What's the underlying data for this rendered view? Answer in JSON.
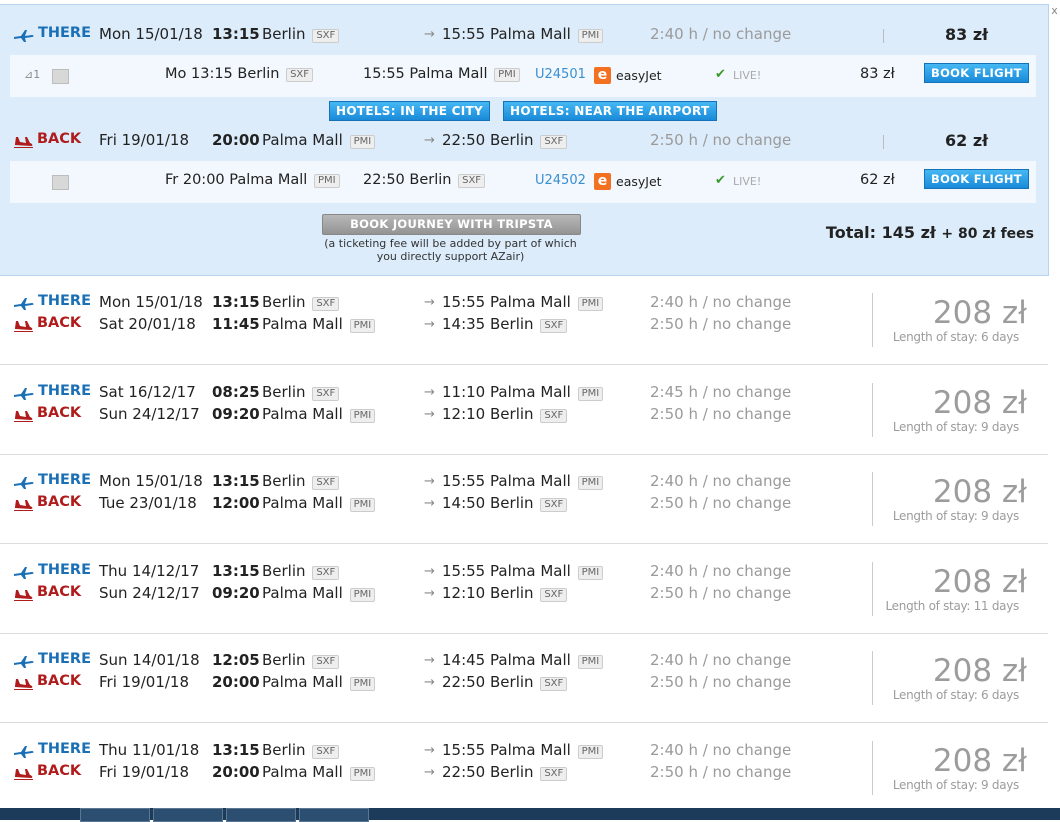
{
  "expanded": {
    "outbound": {
      "dir": "THERE",
      "day": "Mon 15/01/18",
      "time": "13:15",
      "from": "Berlin",
      "from_code": "SXF",
      "arr_time": "15:55",
      "to": "Palma Mall",
      "to_code": "PMI",
      "duration": "2:40 h / no change",
      "price": "83 zł",
      "segment": {
        "stops": "1",
        "dep": "Mo 13:15 Berlin",
        "dep_code": "SXF",
        "arr": "15:55 Palma Mall",
        "arr_code": "PMI",
        "flight_no": "U24501",
        "airline_logo": "e",
        "airline": "easyJet",
        "live": "LIVE!",
        "price": "83 zł",
        "book": "BOOK FLIGHT"
      }
    },
    "hotels_city": "HOTELS: IN THE CITY",
    "hotels_airport": "HOTELS: NEAR THE AIRPORT",
    "inbound": {
      "dir": "BACK",
      "day": "Fri 19/01/18",
      "time": "20:00",
      "from": "Palma Mall",
      "from_code": "PMI",
      "arr_time": "22:50",
      "to": "Berlin",
      "to_code": "SXF",
      "duration": "2:50 h / no change",
      "price": "62 zł",
      "segment": {
        "dep": "Fr 20:00 Palma Mall",
        "dep_code": "PMI",
        "arr": "22:50 Berlin",
        "arr_code": "SXF",
        "flight_no": "U24502",
        "airline_logo": "e",
        "airline": "easyJet",
        "live": "LIVE!",
        "price": "62 zł",
        "book": "BOOK FLIGHT"
      }
    },
    "tripsta_button": "BOOK JOURNEY WITH TRIPSTA",
    "tripsta_note": "(a ticketing fee will be added by part of which you directly support AZair)",
    "total_label": "Total:",
    "total_price": "145 zł",
    "total_fees": "+ 80 zł fees"
  },
  "results": [
    {
      "t_day": "Mon 15/01/18",
      "t_time": "13:15",
      "t_from": "Berlin",
      "t_from_code": "SXF",
      "t_arr": "15:55",
      "t_to": "Palma Mall",
      "t_to_code": "PMI",
      "t_dur": "2:40 h / no change",
      "b_day": "Sat 20/01/18",
      "b_time": "11:45",
      "b_from": "Palma Mall",
      "b_from_code": "PMI",
      "b_arr": "14:35",
      "b_to": "Berlin",
      "b_to_code": "SXF",
      "b_dur": "2:50 h / no change",
      "price": "208 zł",
      "stay": "Length of stay: 6 days"
    },
    {
      "t_day": "Sat 16/12/17",
      "t_time": "08:25",
      "t_from": "Berlin",
      "t_from_code": "SXF",
      "t_arr": "11:10",
      "t_to": "Palma Mall",
      "t_to_code": "PMI",
      "t_dur": "2:45 h / no change",
      "b_day": "Sun 24/12/17",
      "b_time": "09:20",
      "b_from": "Palma Mall",
      "b_from_code": "PMI",
      "b_arr": "12:10",
      "b_to": "Berlin",
      "b_to_code": "SXF",
      "b_dur": "2:50 h / no change",
      "price": "208 zł",
      "stay": "Length of stay: 9 days"
    },
    {
      "t_day": "Mon 15/01/18",
      "t_time": "13:15",
      "t_from": "Berlin",
      "t_from_code": "SXF",
      "t_arr": "15:55",
      "t_to": "Palma Mall",
      "t_to_code": "PMI",
      "t_dur": "2:40 h / no change",
      "b_day": "Tue 23/01/18",
      "b_time": "12:00",
      "b_from": "Palma Mall",
      "b_from_code": "PMI",
      "b_arr": "14:50",
      "b_to": "Berlin",
      "b_to_code": "SXF",
      "b_dur": "2:50 h / no change",
      "price": "208 zł",
      "stay": "Length of stay: 9 days"
    },
    {
      "t_day": "Thu 14/12/17",
      "t_time": "13:15",
      "t_from": "Berlin",
      "t_from_code": "SXF",
      "t_arr": "15:55",
      "t_to": "Palma Mall",
      "t_to_code": "PMI",
      "t_dur": "2:40 h / no change",
      "b_day": "Sun 24/12/17",
      "b_time": "09:20",
      "b_from": "Palma Mall",
      "b_from_code": "PMI",
      "b_arr": "12:10",
      "b_to": "Berlin",
      "b_to_code": "SXF",
      "b_dur": "2:50 h / no change",
      "price": "208 zł",
      "stay": "Length of stay: 11 days"
    },
    {
      "t_day": "Sun 14/01/18",
      "t_time": "12:05",
      "t_from": "Berlin",
      "t_from_code": "SXF",
      "t_arr": "14:45",
      "t_to": "Palma Mall",
      "t_to_code": "PMI",
      "t_dur": "2:40 h / no change",
      "b_day": "Fri 19/01/18",
      "b_time": "20:00",
      "b_from": "Palma Mall",
      "b_from_code": "PMI",
      "b_arr": "22:50",
      "b_to": "Berlin",
      "b_to_code": "SXF",
      "b_dur": "2:50 h / no change",
      "price": "208 zł",
      "stay": "Length of stay: 6 days"
    },
    {
      "t_day": "Thu 11/01/18",
      "t_time": "13:15",
      "t_from": "Berlin",
      "t_from_code": "SXF",
      "t_arr": "15:55",
      "t_to": "Palma Mall",
      "t_to_code": "PMI",
      "t_dur": "2:40 h / no change",
      "b_day": "Fri 19/01/18",
      "b_time": "20:00",
      "b_from": "Palma Mall",
      "b_from_code": "PMI",
      "b_arr": "22:50",
      "b_to": "Berlin",
      "b_to_code": "SXF",
      "b_dur": "2:50 h / no change",
      "price": "208 zł",
      "stay": "Length of stay: 9 days"
    }
  ],
  "labels": {
    "there": "THERE",
    "back": "BACK"
  },
  "arrow_glyph": "→",
  "scroll_close": "x",
  "icons": {
    "outbound": "plane-takeoff-icon",
    "inbound": "plane-landing-icon",
    "arrow": "arrow-right-icon",
    "check": "checkmark-icon"
  },
  "colors": {
    "expanded_bg": "#dcecfb",
    "there": "#1a6fb5",
    "back": "#b01c1c",
    "button": "#1a8ad8",
    "easyjet": "#f37021"
  }
}
